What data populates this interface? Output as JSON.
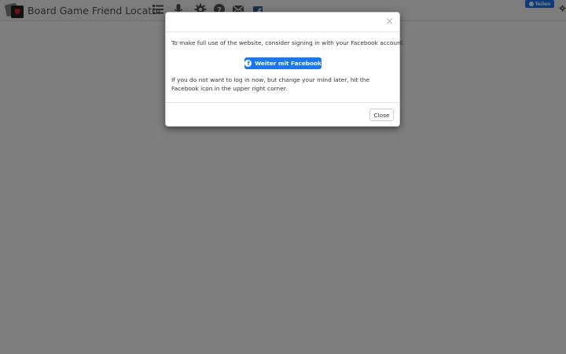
{
  "navbar": {
    "brand_title": "Board Game Friend Locator",
    "icons": [
      "list-icon",
      "microphone-icon",
      "gear-icon",
      "help-icon",
      "mail-icon",
      "facebook-icon"
    ],
    "share_label": "Teilen"
  },
  "modal": {
    "close_symbol": "×",
    "intro_text": "To make full use of the website, consider signing in with your Facebook account.",
    "facebook_button_label": "Weiter mit Facebook",
    "outro_text": "If you do not want to log in now, but change your mind later, hit the Facebook icon in the upper right corner.",
    "close_button_label": "Close"
  },
  "colors": {
    "facebook_blue": "#1877f2",
    "backdrop": "rgba(0,0,0,0.5)",
    "navbar_bg": "#f8f8f8"
  }
}
